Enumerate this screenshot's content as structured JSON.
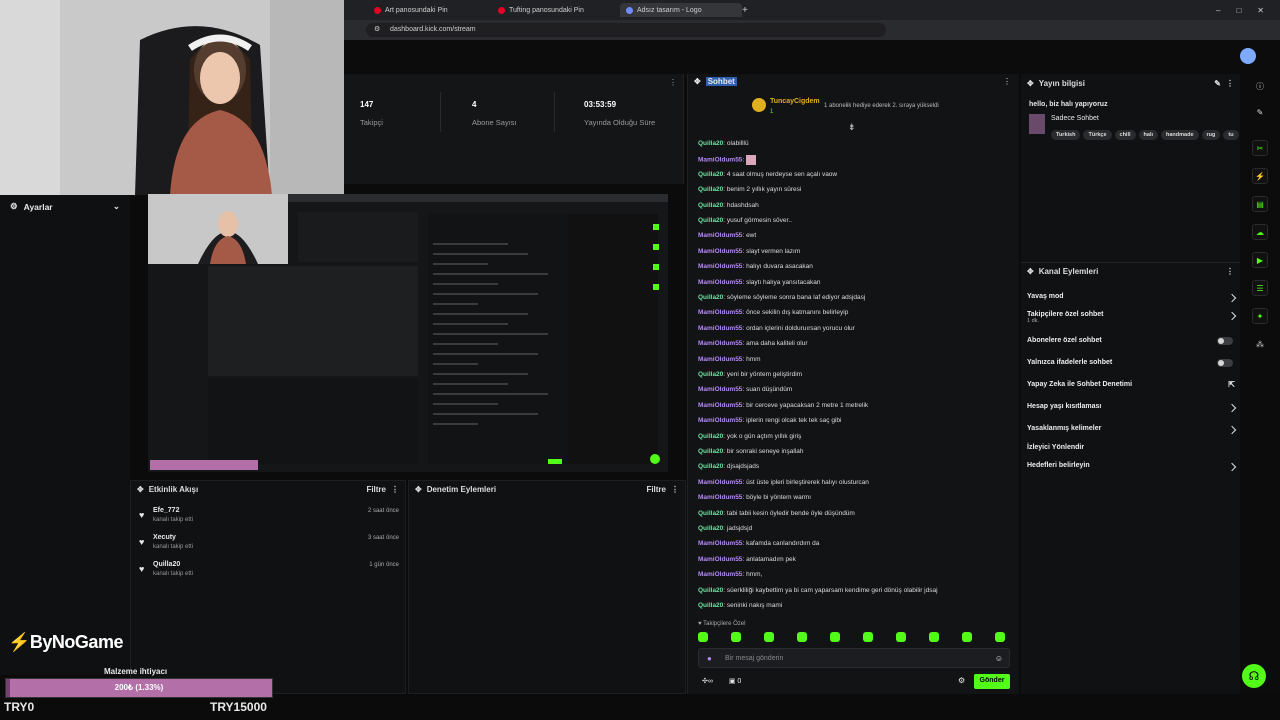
{
  "browser": {
    "tabs": [
      "Art panosundaki Pin",
      "Tufting panosundaki Pin",
      "Adsız tasarım - Logo"
    ],
    "url": "dashboard.kick.com/stream"
  },
  "stats": [
    {
      "num": "147",
      "label": "Takipçi"
    },
    {
      "num": "4",
      "label": "Abone Sayısı"
    },
    {
      "num": "03:53:59",
      "label": "Yayında Olduğu Süre"
    }
  ],
  "ayarlar": {
    "title": "Ayarlar"
  },
  "activity": {
    "title": "Etkinlik Akışı",
    "filter": "Filtre",
    "items": [
      {
        "name": "Efe_772",
        "desc": "kanalı takip etti",
        "time": "2 saat önce"
      },
      {
        "name": "Xecuty",
        "desc": "kanalı takip etti",
        "time": "3 saat önce"
      },
      {
        "name": "Quilla20",
        "desc": "kanalı takip etti",
        "time": "1 gün önce"
      }
    ]
  },
  "moderation": {
    "title": "Denetim Eylemleri",
    "filter": "Filtre"
  },
  "chat": {
    "title": "Sohbet",
    "pinned_user": "TuncayCigdem",
    "pinned_count": "1",
    "pinned_text": "1 abonelik hediye ederek 2. sıraya yükseldi",
    "messages": [
      {
        "user": "Quilla20",
        "text": "olabilllü",
        "c": "g"
      },
      {
        "user": "MamiOldum55",
        "text": "",
        "c": "p"
      },
      {
        "user": "Quilla20",
        "text": "4 saat olmuş nerdeyse sen açalı vaow",
        "c": "g"
      },
      {
        "user": "Quilla20",
        "text": "benim 2 yıllık yayın süresi",
        "c": "g"
      },
      {
        "user": "Quilla20",
        "text": "hdashdsah",
        "c": "g"
      },
      {
        "user": "Quilla20",
        "text": "yusuf görmesin söver..",
        "c": "g"
      },
      {
        "user": "MamiOldum55",
        "text": "ewt",
        "c": "p"
      },
      {
        "user": "MamiOldum55",
        "text": "slayt vermen lazım",
        "c": "p"
      },
      {
        "user": "MamiOldum55",
        "text": "halıyı duvara asacakan",
        "c": "p"
      },
      {
        "user": "MamiOldum55",
        "text": "slaytı halıya yansıtacakan",
        "c": "p"
      },
      {
        "user": "Quilla20",
        "text": "söyleme söyleme sonra bana laf ediyor adsjdasj",
        "c": "g"
      },
      {
        "user": "MamiOldum55",
        "text": "önce sekilin dış katmanını belirleyip",
        "c": "p"
      },
      {
        "user": "MamiOldum55",
        "text": "ordan içlerini dolduruırsan yorucu olur",
        "c": "p"
      },
      {
        "user": "MamiOldum55",
        "text": "ama daha kaliteli olur",
        "c": "p"
      },
      {
        "user": "MamiOldum55",
        "text": "hmm",
        "c": "p"
      },
      {
        "user": "Quilla20",
        "text": "yeni bir yöntem geliştirdim",
        "c": "g"
      },
      {
        "user": "MamiOldum55",
        "text": "suan düşündüm",
        "c": "p"
      },
      {
        "user": "MamiOldum55",
        "text": "bir cerceve yapacaksan 2 metre 1 metrelik",
        "c": "p"
      },
      {
        "user": "MamiOldum55",
        "text": "iplerin rengi olcak tek tek saç gibi",
        "c": "p"
      },
      {
        "user": "Quilla20",
        "text": "yok o gün açtım yıllık giriş",
        "c": "g"
      },
      {
        "user": "Quilla20",
        "text": "bir sonraki seneye inşallah",
        "c": "g"
      },
      {
        "user": "Quilla20",
        "text": "djsajdsjads",
        "c": "g"
      },
      {
        "user": "MamiOldum55",
        "text": "üst üste ipleri birleştirerek halıyı olusturcan",
        "c": "p"
      },
      {
        "user": "MamiOldum55",
        "text": "böyle bi yöntem warmı",
        "c": "p"
      },
      {
        "user": "Quilla20",
        "text": "tabi tabii kesin öyledir bende öyle düşündüm",
        "c": "g"
      },
      {
        "user": "Quilla20",
        "text": "jadsjdsjd",
        "c": "g"
      },
      {
        "user": "MamiOldum55",
        "text": "kafamda canlandırdım da",
        "c": "p"
      },
      {
        "user": "MamiOldum55",
        "text": "anlatamadım pek",
        "c": "p"
      },
      {
        "user": "MamiOldum55",
        "text": "hmm,",
        "c": "p"
      },
      {
        "user": "Quilla20",
        "text": "süerkliliği kaybettim ya bi cam yaparsam kendime geri dönüş olabilir jdsaj",
        "c": "g"
      },
      {
        "user": "Quilla20",
        "text": "seninki nakış mami",
        "c": "g"
      }
    ],
    "followers_only": "Takipçilere Özel",
    "input_placeholder": "Bir mesaj gönderin",
    "count": "0",
    "send": "Gönder"
  },
  "stream_info": {
    "title": "Yayın bilgisi",
    "stream_title": "hello, biz halı yapıyoruz",
    "category": "Sadece Sohbet",
    "tags": [
      "Turkish",
      "Türkçe",
      "chill",
      "halı",
      "handmade",
      "rug",
      "tu"
    ]
  },
  "channel_actions": {
    "title": "Kanal Eylemleri",
    "items": [
      {
        "label": "Yavaş mod",
        "sub": "",
        "kind": "chev"
      },
      {
        "label": "Takipçilere özel sohbet",
        "sub": "1 dk.",
        "kind": "chev"
      },
      {
        "label": "Abonelere özel sohbet",
        "sub": "",
        "kind": "toggle"
      },
      {
        "label": "Yalnızca ifadelerle sohbet",
        "sub": "",
        "kind": "toggle"
      },
      {
        "label": "Yapay Zeka ile Sohbet Denetimi",
        "sub": "",
        "kind": "ext"
      },
      {
        "label": "Hesap yaşı kısıtlaması",
        "sub": "",
        "kind": "chev"
      },
      {
        "label": "Yasaklanmış kelimeler",
        "sub": "",
        "kind": "chev"
      },
      {
        "label": "İzleyici Yönlendir",
        "sub": "",
        "kind": "none"
      },
      {
        "label": "Hedefleri belirleyin",
        "sub": "",
        "kind": "chev"
      }
    ]
  },
  "overlay": {
    "logo": "ByNoGame",
    "goal_title": "Malzeme ihtiyacı",
    "goal_value": "200₺ (1.33%)",
    "goal_progress": 0.0133,
    "goal_min": "TRY0",
    "goal_max": "TRY15000"
  },
  "colors": {
    "kick_green": "#53fc18",
    "mami": "#b489f4",
    "quilla": "#6ee1a2"
  }
}
